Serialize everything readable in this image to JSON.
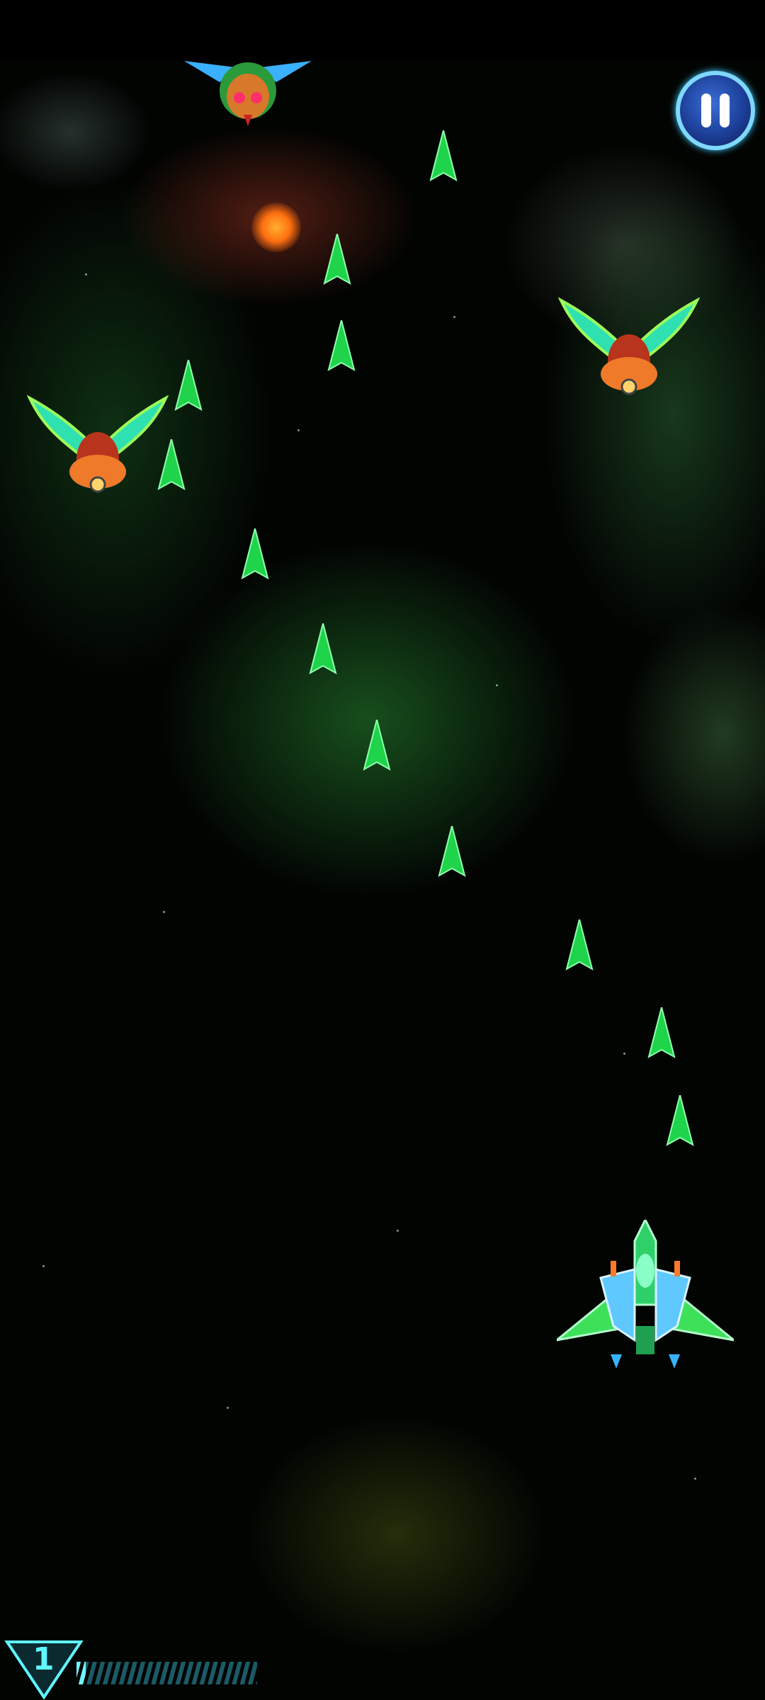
{
  "hud": {
    "level": "1",
    "level_progress": 0.05
  },
  "icons": {
    "pause": "pause-icon",
    "level_badge": "triangle-badge-icon",
    "player": "fighter-jet-icon",
    "enemy": "winged-chicken-alien-icon",
    "bullet": "green-arrow-bullet-icon"
  },
  "colors": {
    "bullet": "#1fd34a",
    "hud_accent": "#5ff6ff",
    "pause_button": "#1d3f99"
  }
}
